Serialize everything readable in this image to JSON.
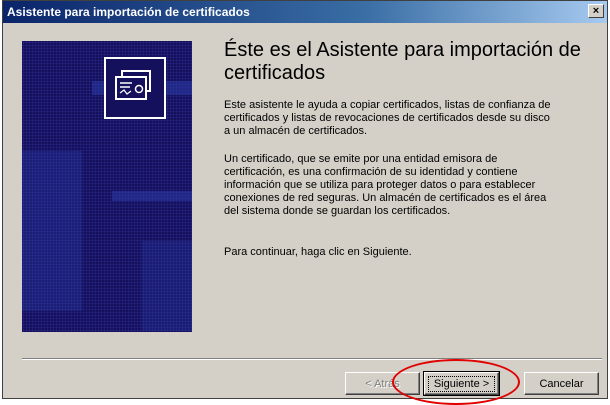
{
  "window": {
    "title": "Asistente para importación de certificados",
    "close_glyph": "×"
  },
  "wizard": {
    "heading": "Éste es el Asistente para importación de certificados",
    "paragraphs": [
      "Este asistente le ayuda a copiar certificados, listas de confianza de certificados y listas de revocaciones de certificados desde su disco a un almacén de certificados.",
      "Un certificado, que se emite por una entidad emisora de certificación, es una confirmación de su identidad y contiene información que se utiliza para proteger datos o para establecer conexiones de red seguras. Un almacén de certificados es el área del sistema donde se guardan los certificados.",
      "Para continuar, haga clic en Siguiente."
    ],
    "side_icon": "certificate-icon"
  },
  "buttons": {
    "back": "< Atrás",
    "next": "Siguiente >",
    "cancel": "Cancelar"
  },
  "colors": {
    "titlebar_start": "#0a246a",
    "side_panel": "#14105c",
    "dialog_face": "#d4d0c8",
    "annotation": "#e00000"
  }
}
